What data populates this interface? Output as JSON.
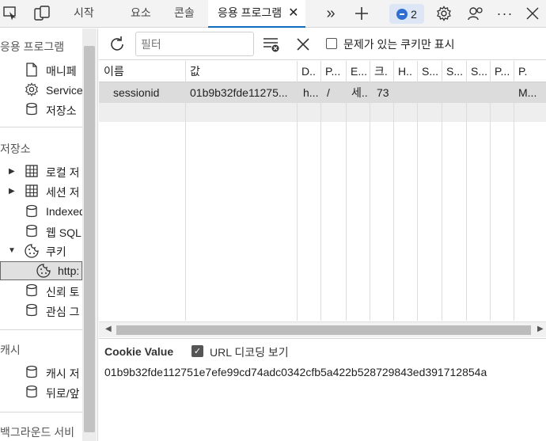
{
  "tabbar": {
    "tabs": [
      {
        "label": "시작"
      },
      {
        "label": "요소"
      },
      {
        "label": "콘솔"
      },
      {
        "label": "응용 프로그램",
        "active": true
      }
    ],
    "issues_count": "2"
  },
  "sidebar": {
    "app_section": "응용 프로그램",
    "app_items": [
      {
        "label": "매니페",
        "icon": "file-icon"
      },
      {
        "label": "Service",
        "icon": "gear-icon"
      },
      {
        "label": "저장소",
        "icon": "database-icon"
      }
    ],
    "storage_section": "저장소",
    "storage_items": [
      {
        "label": "로컬 저",
        "icon": "grid-icon",
        "expandable": true
      },
      {
        "label": "세션 저",
        "icon": "grid-icon",
        "expandable": true
      },
      {
        "label": "Indexed",
        "icon": "database-icon"
      },
      {
        "label": "웹 SQL",
        "icon": "database-icon"
      },
      {
        "label": "쿠키",
        "icon": "cookie-icon",
        "expanded": true
      },
      {
        "label": "http:",
        "icon": "cookie-icon",
        "selected": true
      },
      {
        "label": "신뢰 토",
        "icon": "database-icon"
      },
      {
        "label": "관심 그",
        "icon": "database-icon"
      }
    ],
    "cache_section": "캐시",
    "cache_items": [
      {
        "label": "캐시 저",
        "icon": "database-icon"
      },
      {
        "label": "뒤로/앞",
        "icon": "database-icon"
      }
    ],
    "background_section": "백그라운드 서비"
  },
  "toolbar": {
    "filter_placeholder": "필터",
    "issues_only_label": "문제가 있는 쿠키만 표시",
    "issues_only_checked": false
  },
  "table": {
    "columns": [
      "이름",
      "값",
      "D..",
      "P...",
      "E...",
      "크.",
      "H..",
      "S...",
      "S...",
      "S...",
      "P...",
      "P."
    ],
    "rows": [
      [
        "sessionid",
        "01b9b32fde11275...",
        "h...",
        "/",
        "세...",
        "73",
        "",
        "",
        "",
        "",
        "",
        "M..."
      ]
    ]
  },
  "value_pane": {
    "title": "Cookie Value",
    "decode_label": "URL 디코딩 보기",
    "decode_checked": true,
    "value": "01b9b32fde112751e7efe99cd74adc0342cfb5a422b528729843ed391712854a"
  },
  "colors": {
    "accent": "#0f6cbd",
    "selected_row": "#dcdcdc",
    "panel_bg": "#f3f3f3"
  }
}
